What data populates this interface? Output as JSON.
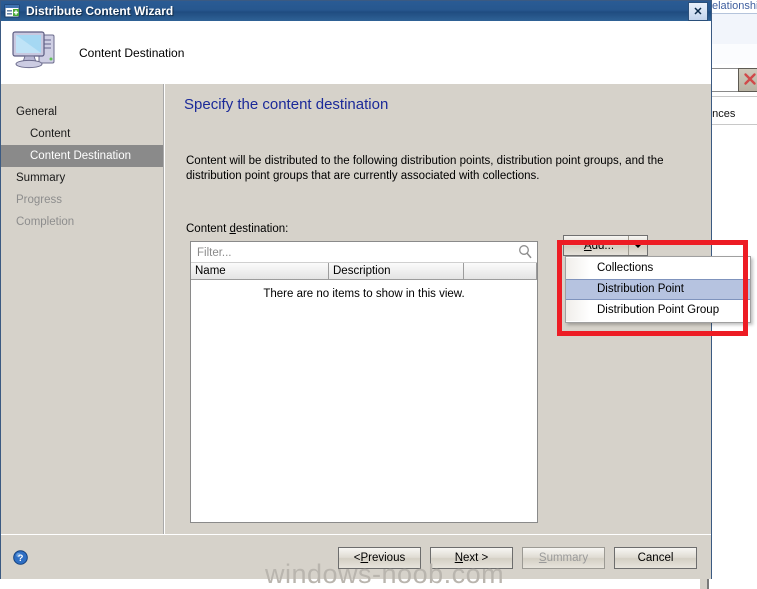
{
  "window": {
    "title": "Distribute Content Wizard",
    "close_label": "✕",
    "titlebar_icon": "window-plus-icon"
  },
  "header": {
    "title": "Content Destination",
    "icon": "computer-icon"
  },
  "sidebar": {
    "items": [
      {
        "label": "General",
        "indent": false,
        "state": "normal"
      },
      {
        "label": "Content",
        "indent": true,
        "state": "normal"
      },
      {
        "label": "Content Destination",
        "indent": true,
        "state": "selected"
      },
      {
        "label": "Summary",
        "indent": false,
        "state": "normal"
      },
      {
        "label": "Progress",
        "indent": false,
        "state": "disabled"
      },
      {
        "label": "Completion",
        "indent": false,
        "state": "disabled"
      }
    ]
  },
  "main": {
    "heading": "Specify the content destination",
    "description": "Content will be distributed to the following distribution points, distribution point groups, and the distribution point groups that are currently associated with collections.",
    "field_label_pre": "Content ",
    "field_label_accel": "d",
    "field_label_post": "estination:",
    "filter": {
      "value": "",
      "placeholder": "Filter...",
      "icon": "search-icon"
    },
    "columns": [
      "Name",
      "Description"
    ],
    "empty_message": "There are no items to show in this view.",
    "error_icon": "error-exclamation-icon"
  },
  "add_control": {
    "label_pre": "",
    "label_accel": "A",
    "label_post": "dd...",
    "caret_icon": "chevron-down-icon",
    "menu": [
      {
        "label": "Collections",
        "hovered": false
      },
      {
        "label": "Distribution Point",
        "hovered": true
      },
      {
        "label": "Distribution Point Group",
        "hovered": false
      }
    ]
  },
  "footer": {
    "help_icon": "help-question-icon",
    "buttons": [
      {
        "label_pre": "< ",
        "label_accel": "P",
        "label_post": "revious",
        "disabled": false
      },
      {
        "label_pre": "",
        "label_accel": "N",
        "label_post": "ext >",
        "disabled": false
      },
      {
        "label_pre": "",
        "label_accel": "S",
        "label_post": "ummary",
        "disabled": true
      },
      {
        "label_pre": "",
        "label_accel": "",
        "label_post": "Cancel",
        "disabled": false
      }
    ]
  },
  "background_window": {
    "tab_text": "elationship",
    "label_text": "ences",
    "delete_icon": "red-x-delete-icon"
  },
  "watermark": {
    "text": "windows-noob.com"
  },
  "colors": {
    "accent_heading": "#1b2a99",
    "titlebar": "#27578e",
    "dialog_face": "#d6d2ca",
    "selection": "#8a8a8a",
    "menu_hover": "#b6c3e0",
    "annotation_red": "#ed1c24",
    "error_red": "#e03020"
  }
}
